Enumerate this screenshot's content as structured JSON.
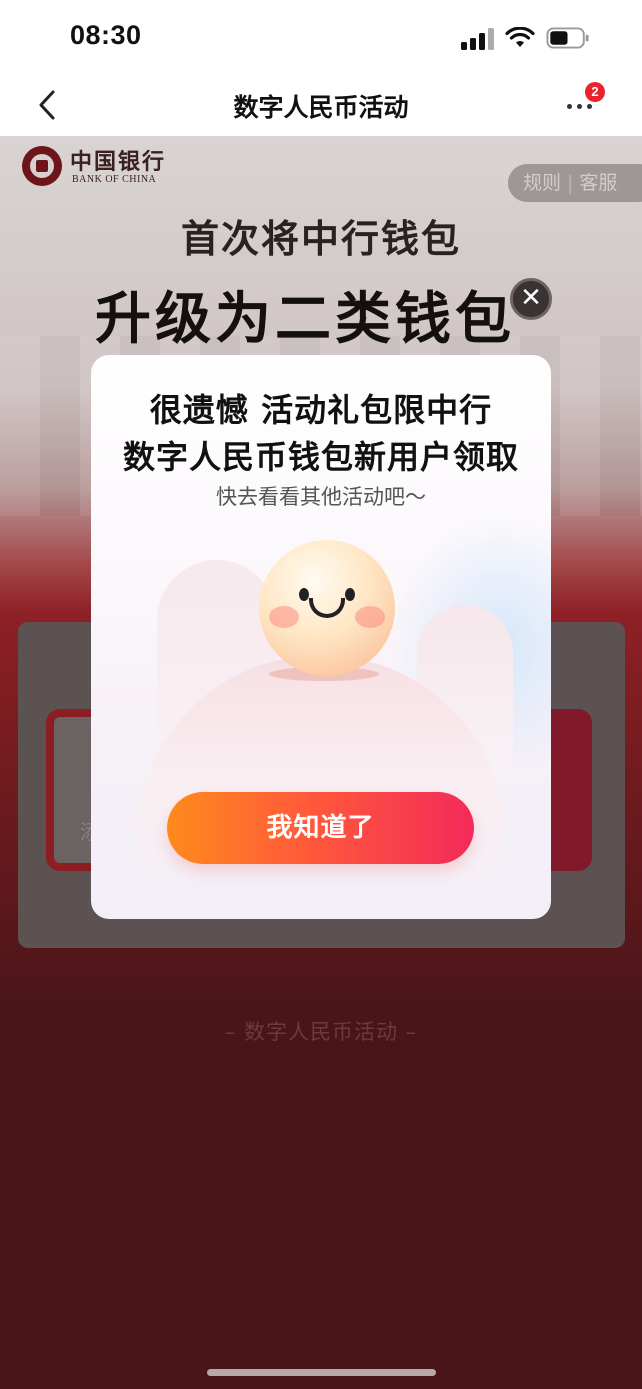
{
  "status_bar": {
    "time": "08:30",
    "icons": [
      "signal-icon",
      "wifi-icon",
      "battery-icon"
    ],
    "battery_level": 0.55
  },
  "nav": {
    "title": "数字人民币活动",
    "back_icon": "chevron-left-icon",
    "more_icon": "more-dots-icon",
    "badge_count": "2"
  },
  "page": {
    "brand_cn": "中国银行",
    "brand_en": "BANK OF CHINA",
    "rules_label": "规则",
    "service_label": "客服",
    "separator": "|",
    "headline_1": "首次将中行钱包",
    "headline_2": "升级为二类钱包",
    "card_char": "添",
    "footer": "– 数字人民币活动 –"
  },
  "modal": {
    "close_icon": "close-icon",
    "close_glyph": "✕",
    "title_line_1": "很遗憾 活动礼包限中行",
    "title_line_2": "数字人民币钱包新用户领取",
    "subtitle": "快去看看其他活动吧～",
    "button_label": "我知道了"
  },
  "colors": {
    "accent_red": "#e8232e",
    "button_start": "#ff8a1c",
    "button_end": "#f32a5a",
    "page_dark": "#4a1518"
  }
}
